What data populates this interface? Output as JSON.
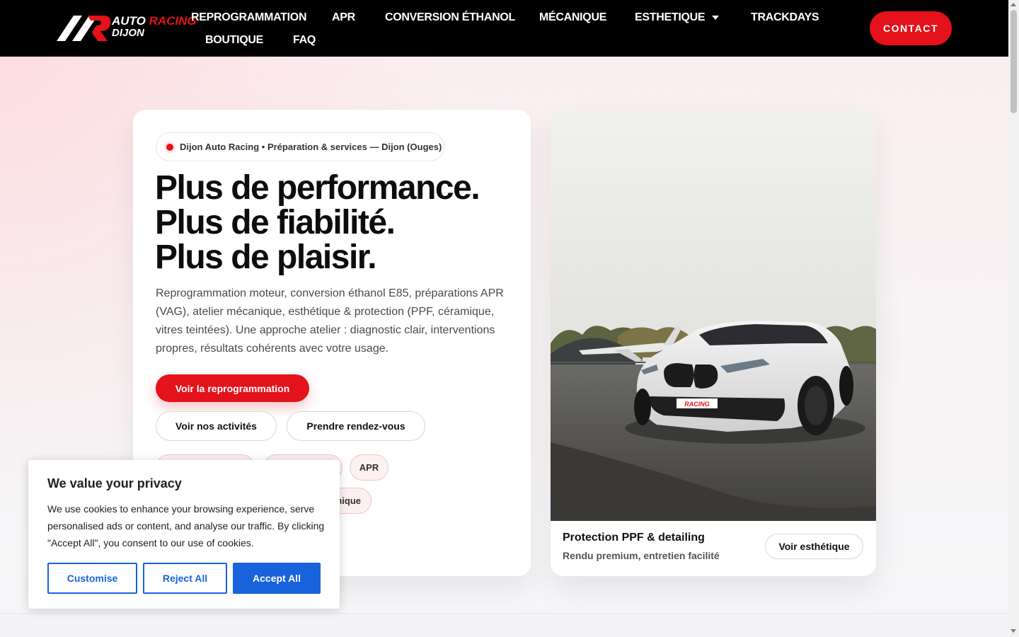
{
  "header": {
    "logo": {
      "line1a": "AUTO ",
      "line1b": "RACING",
      "line2": "DIJON"
    },
    "nav": [
      {
        "label": "REPROGRAMMATION"
      },
      {
        "label": "APR"
      },
      {
        "label": "CONVERSION ÉTHANOL"
      },
      {
        "label": "MÉCANIQUE"
      },
      {
        "label": "ESTHETIQUE"
      },
      {
        "label": "TRACKDAYS"
      },
      {
        "label": "BOUTIQUE"
      },
      {
        "label": "FAQ"
      }
    ],
    "contact_label": "CONTACT"
  },
  "hero": {
    "badge": "Dijon Auto Racing • Préparation & services — Dijon (Ouges)",
    "headline": [
      "Plus de performance.",
      "Plus de fiabilité.",
      "Plus de plaisir."
    ],
    "intro": "Reprogrammation moteur, conversion éthanol E85, préparations APR (VAG), atelier mécanique, esthétique & protection (PPF, céramique, vitres teintées). Une approche atelier : diagnostic clair, interventions propres, résultats cohérents avec votre usage.",
    "primary_cta": "Voir la reprogrammation",
    "secondary_ctas": [
      "Voir nos activités",
      "Prendre rendez-vous"
    ],
    "chips": [
      "APR",
      "nique"
    ]
  },
  "feature_card": {
    "title": "Protection PPF & detailing",
    "subtitle": "Rendu premium, entretien facilité",
    "button": "Voir esthétique",
    "plate_text": "RACING"
  },
  "cookie": {
    "title": "We value your privacy",
    "text": "We use cookies to enhance your browsing experience, serve personalised ads or content, and analyse our traffic. By clicking \"Accept All\", you consent to our use of cookies.",
    "customise": "Customise",
    "reject": "Reject All",
    "accept": "Accept All"
  },
  "colors": {
    "brand_red": "#e3121b",
    "header_bg": "#000000",
    "cookie_blue": "#1863dc"
  }
}
